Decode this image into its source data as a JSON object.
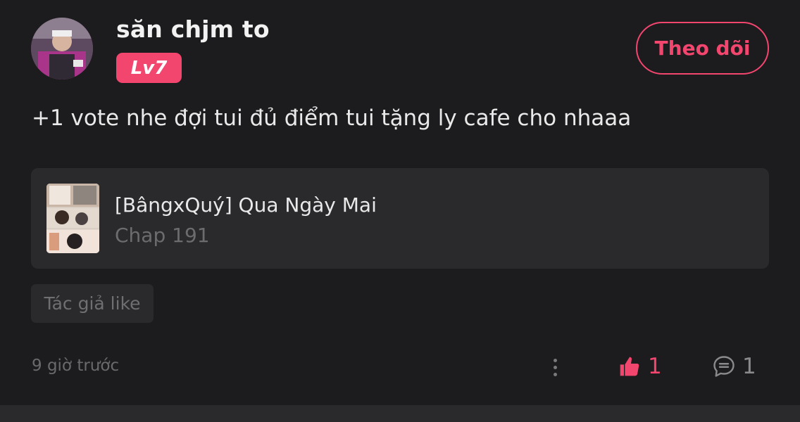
{
  "user": {
    "name": "săn chjm to",
    "level": "Lv7",
    "avatar_icon": "user-avatar"
  },
  "follow_button_label": "Theo dõi",
  "comment": {
    "text": "+1 vote nhe đợi tui đủ điểm tui tặng ly cafe cho nhaaa"
  },
  "chapter": {
    "title": "[BângxQuý] Qua Ngày Mai",
    "subtitle": "Chap 191"
  },
  "tag": "Tác giả like",
  "footer": {
    "timestamp": "9 giờ trước",
    "like_count": "1",
    "comment_count": "1"
  },
  "colors": {
    "accent": "#f2466f",
    "background": "#1c1b1d",
    "card": "#2a292c",
    "muted_text": "#6c6b6e"
  },
  "icons": {
    "like": "thumbs-up-icon",
    "comment": "speech-bubble-icon",
    "more": "vertical-dots-icon"
  }
}
